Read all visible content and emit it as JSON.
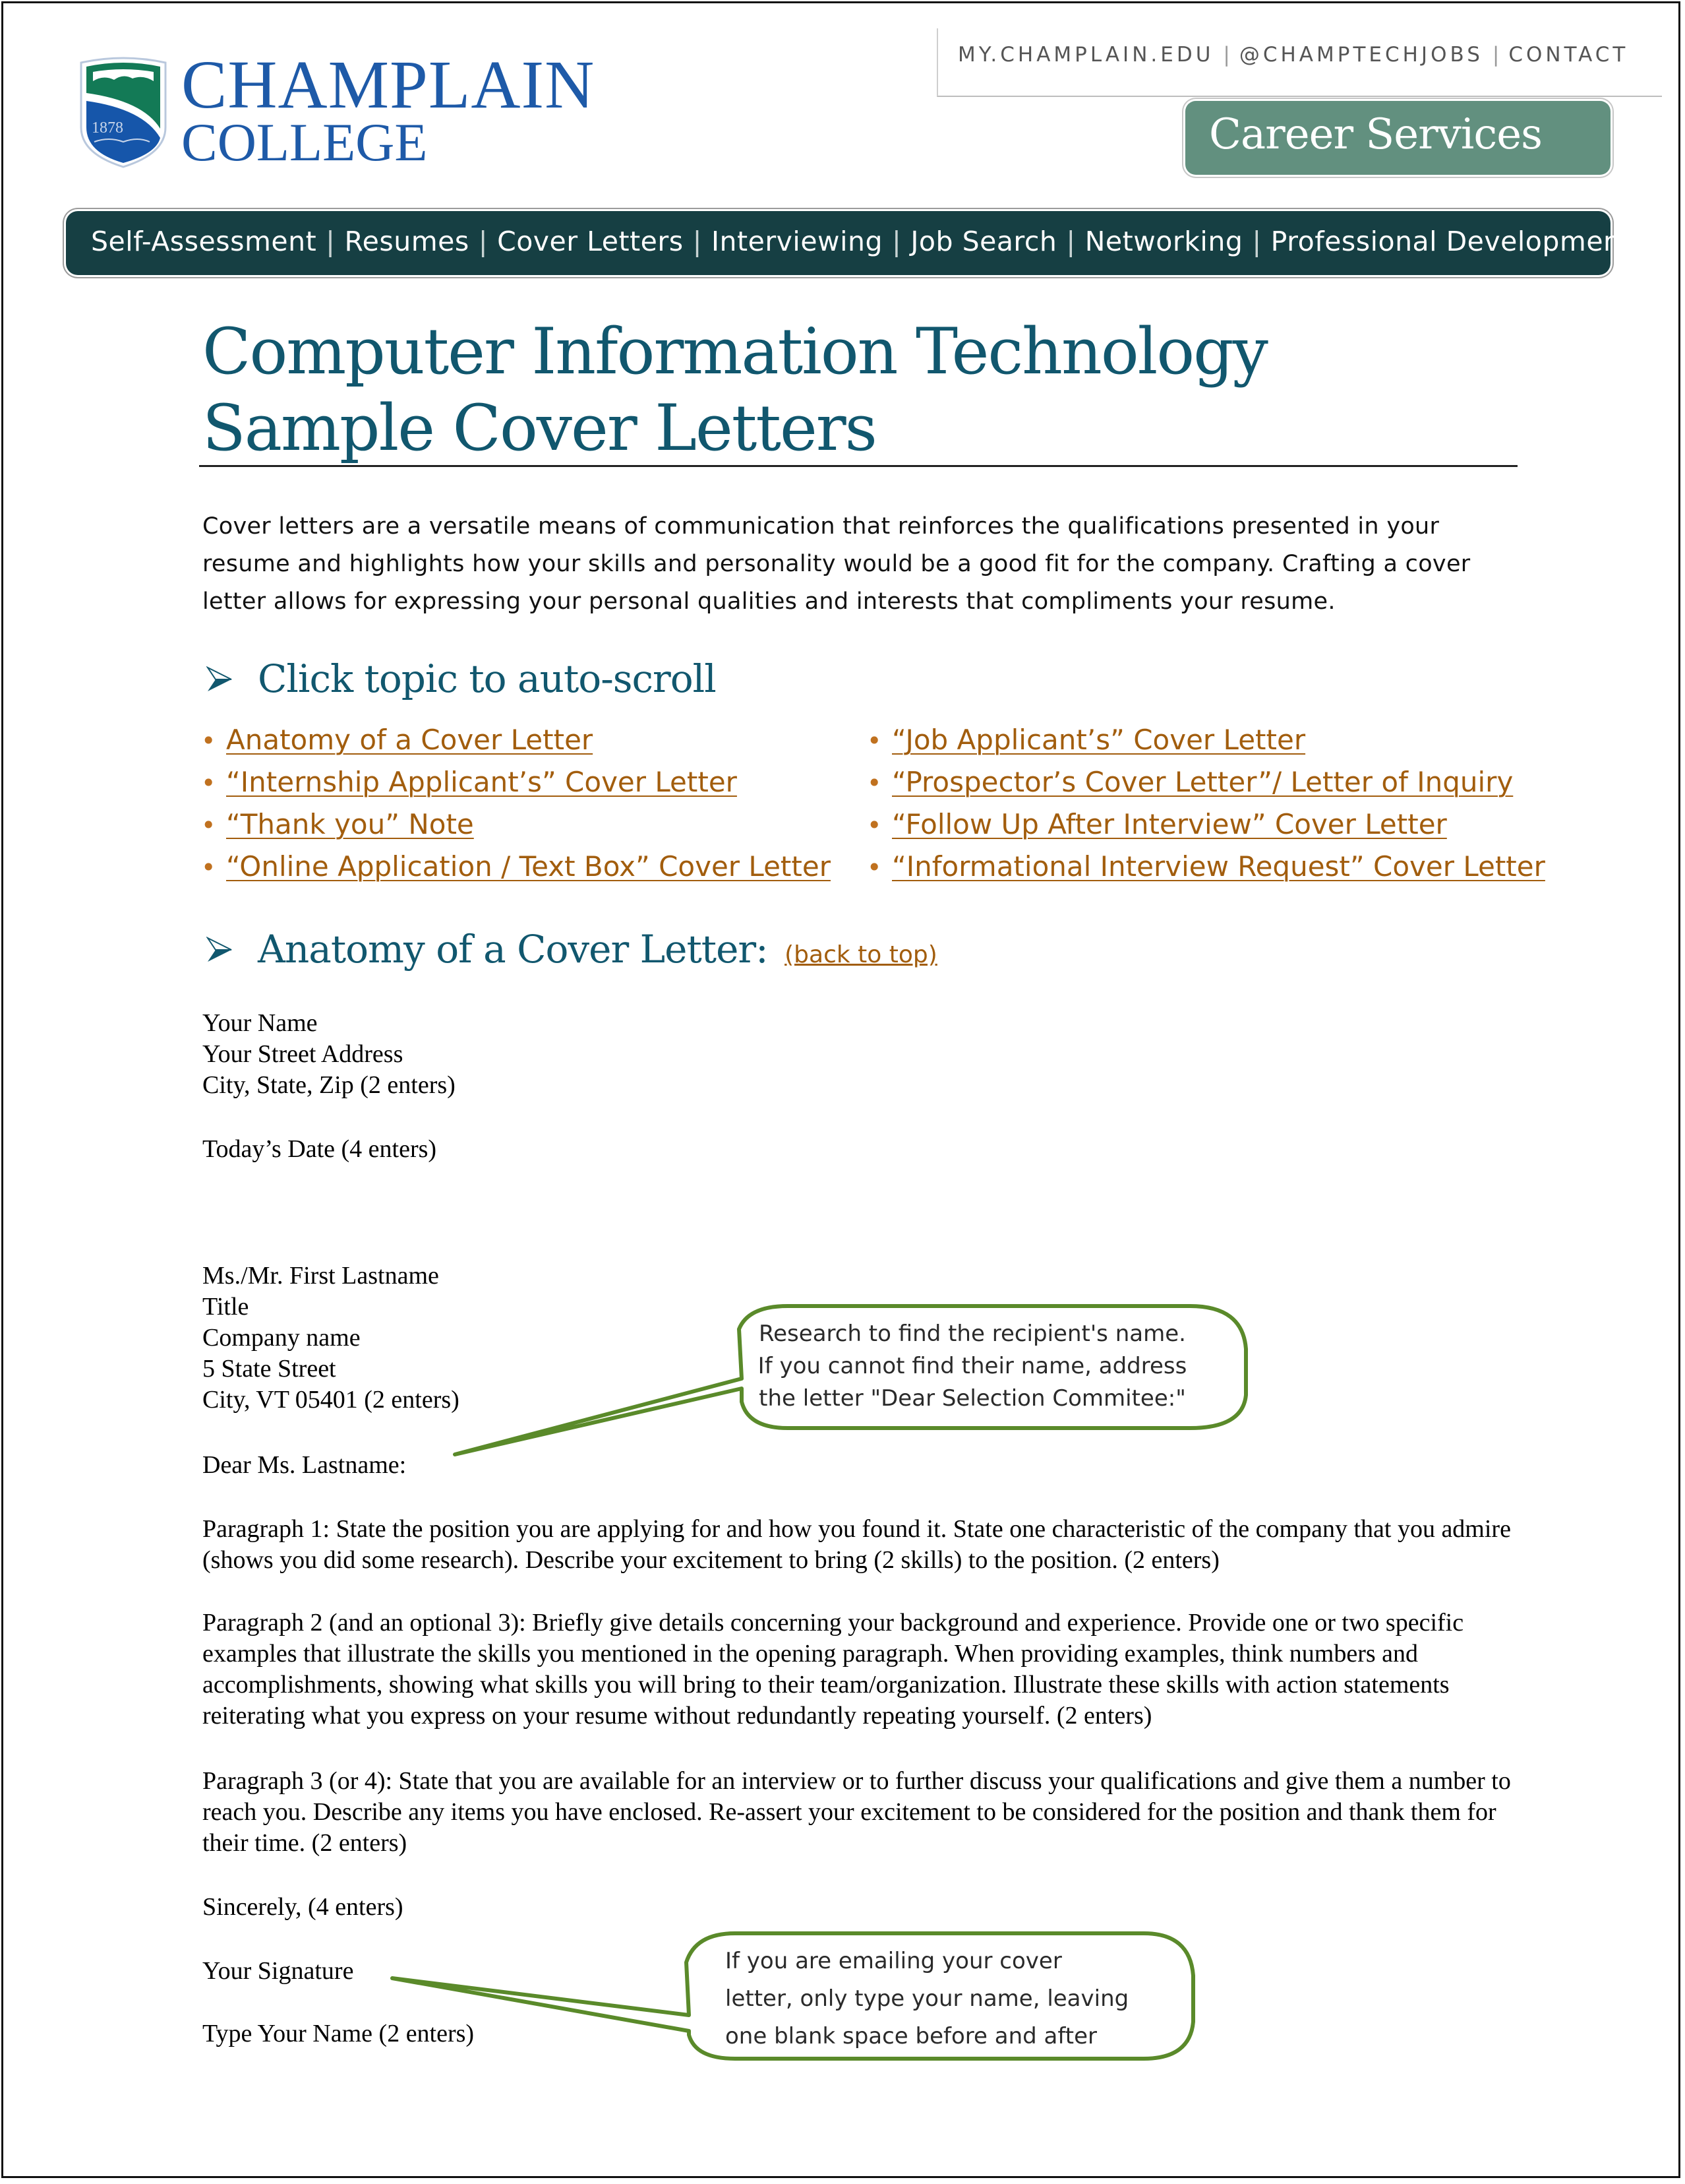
{
  "logo": {
    "name_line1": "CHAMPLAIN",
    "name_line2": "COLLEGE",
    "crest_year": "1878",
    "crest_icon": "college-crest-shield"
  },
  "top_links": [
    {
      "label": "MY.CHAMPLAIN.EDU"
    },
    {
      "label": "@CHAMPTECHJOBS"
    },
    {
      "label": "CONTACT"
    }
  ],
  "top_links_separator": "|",
  "badge": {
    "label": "Career Services"
  },
  "nav": {
    "separator": "|",
    "items": [
      {
        "label": "Self-Assessment"
      },
      {
        "label": "Resumes"
      },
      {
        "label": "Cover Letters"
      },
      {
        "label": "Interviewing"
      },
      {
        "label": "Job Search"
      },
      {
        "label": "Networking"
      },
      {
        "label": "Professional Development"
      }
    ]
  },
  "title": {
    "line1": "Computer Information Technology",
    "line2": "Sample Cover Letters"
  },
  "intro": "Cover letters are a versatile means of communication that reinforces the qualifications presented in your resume and highlights how your skills and personality would be a good fit for the company. Crafting a cover letter allows for expressing your personal qualities and interests that compliments your resume.",
  "topics_section": {
    "heading": "Click topic to auto-scroll",
    "icon": "arrow-bullet-icon",
    "bullet": "•",
    "left_links": [
      {
        "label": "Anatomy of a Cover Letter"
      },
      {
        "label": "“Internship Applicant’s” Cover Letter"
      },
      {
        "label": "“Thank you” Note"
      },
      {
        "label": "“Online Application / Text Box” Cover Letter"
      }
    ],
    "right_links": [
      {
        "label": "“Job Applicant’s” Cover Letter"
      },
      {
        "label": "“Prospector’s Cover Letter”/ Letter of Inquiry"
      },
      {
        "label": "“Follow Up After Interview” Cover Letter"
      },
      {
        "label": "“Informational Interview Request” Cover Letter"
      }
    ]
  },
  "anatomy_section": {
    "heading": "Anatomy of a Cover Letter:",
    "back_to_top": "(back to top)"
  },
  "letter": {
    "sender": [
      "Your Name",
      "Your Street Address",
      "City, State, Zip (2 enters)"
    ],
    "date": "Today’s Date (4 enters)",
    "recipient": [
      "Ms./Mr. First Lastname",
      "Title",
      "Company name",
      "5 State Street",
      "City, VT 05401 (2 enters)"
    ],
    "salutation": "Dear Ms. Lastname:",
    "paragraph1": "Paragraph 1: State the position you are applying for and how you found it. State one characteristic of the company that you admire (shows you did some research). Describe your excitement to bring (2 skills) to the position. (2 enters)",
    "paragraph2": "Paragraph 2 (and an optional 3): Briefly give details concerning your background and experience. Provide one or two specific examples that illustrate the skills you mentioned in the opening paragraph. When providing examples, think numbers and accomplishments, showing what skills you will bring to their team/organization. Illustrate these skills with action statements reiterating what you express on your resume without redundantly repeating yourself. (2 enters)",
    "paragraph3": "Paragraph 3 (or 4): State that you are available for an interview or to further discuss your qualifications and give them a number to reach you. Describe any items you have enclosed. Re-assert your excitement to be considered for the position and thank them for their time. (2 enters)",
    "closing": "Sincerely, (4 enters)",
    "signature": "Your Signature",
    "typed_name": "Type Your Name (2 enters)"
  },
  "callouts": [
    {
      "lines": [
        "Research to find the recipient's name.",
        "If you cannot find their name, address",
        "the letter \"Dear Selection Commitee:\""
      ]
    },
    {
      "lines": [
        "If you are emailing your cover",
        "letter, only type your name, leaving",
        "one blank space before and after"
      ]
    }
  ],
  "colors": {
    "brand_blue": "#1e5aa8",
    "title_teal": "#11576e",
    "nav_bg": "#163f43",
    "badge_green": "#62907f",
    "link_orange": "#a25d0d",
    "callout_green": "#5a8a2a"
  }
}
